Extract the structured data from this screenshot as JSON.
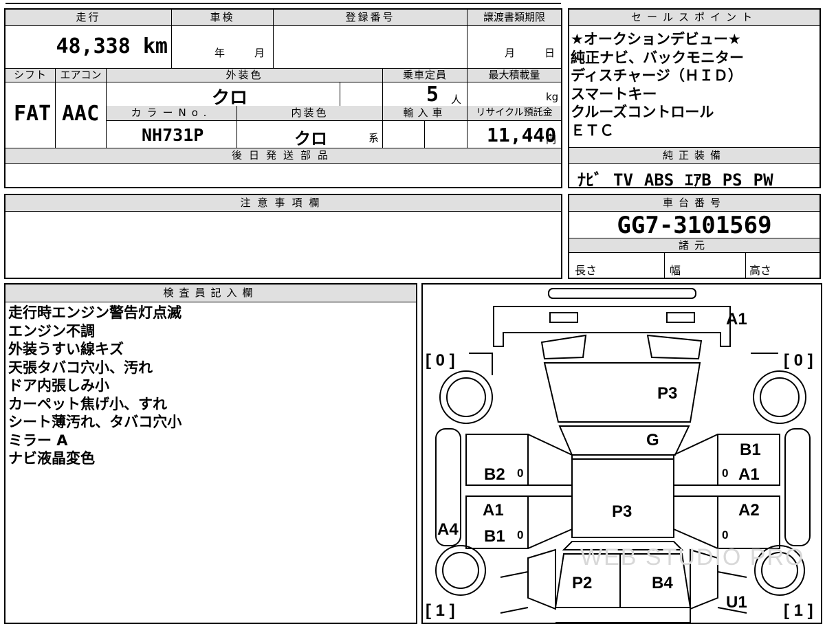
{
  "headers": {
    "mileage": "走行",
    "inspection": "車検",
    "registration": "登録番号",
    "transfer_deadline": "譲渡書類期限",
    "shift": "シフト",
    "aircon": "エアコン",
    "exterior_color": "外装色",
    "capacity": "乗車定員",
    "max_load": "最大積載量",
    "color_no": "カラーNo.",
    "interior_color": "内装色",
    "import": "輸入車",
    "recycle": "リサイクル預託金",
    "later_parts": "後日発送部品",
    "sales_points": "セールスポイント",
    "standard_equipment": "純正装備",
    "notes": "注意事項欄",
    "chassis_no": "車台番号",
    "specs": "諸元",
    "inspector": "検査員記入欄"
  },
  "vehicle": {
    "mileage": "48,338 km",
    "inspection_year_unit": "年",
    "inspection_month_unit": "月",
    "deadline_month_unit": "月",
    "deadline_day_unit": "日",
    "shift": "FAT",
    "aircon": "AAC",
    "exterior_color": "クロ",
    "capacity": "5",
    "capacity_unit": "人",
    "max_load_unit": "kg",
    "color_no": "NH731P",
    "interior_color": "クロ",
    "interior_suffix": "系",
    "recycle_fee": "11,440",
    "recycle_unit": "円",
    "chassis_no": "GG7-3101569"
  },
  "sales_points": [
    "★オークションデビュー★",
    "純正ナビ、バックモニター",
    "ディスチャージ（ＨＩＤ）",
    "スマートキー",
    "クルーズコントロール",
    "ＥＴＣ"
  ],
  "equipment": [
    "ﾅﾋﾞ",
    "TV",
    "ABS",
    "ｴｱB",
    "PS",
    "PW"
  ],
  "specs": {
    "length": "長さ",
    "width": "幅",
    "height": "高さ"
  },
  "inspector_notes": [
    "走行時エンジン警告灯点滅",
    "エンジン不調",
    "外装うすい線キズ",
    "天張タバコ穴小、汚れ",
    "ドア内張しみ小",
    "カーペット焦げ小、すれ",
    "シート薄汚れ、タバコ穴小",
    "ミラー A",
    "ナビ液晶変色"
  ],
  "diagram": {
    "tire_fl": "[ 0 ]",
    "tire_fr": "[ 0 ]",
    "tire_rl": "[ 1 ]",
    "tire_rr": "[ 1 ]",
    "front_bumper": "A1",
    "hood": "P3",
    "windshield": "G",
    "roof": "P3",
    "right_front_fender": "B1",
    "right_front_door": "A1",
    "right_rear_door": "A2",
    "left_front_door": "B2",
    "left_rear_door_a": "A1",
    "left_rear_door_b": "B1",
    "left_sill": "A4",
    "rear_left": "P2",
    "rear_right": "B4",
    "rear_bumper_right": "U1",
    "mark_zero": "0"
  },
  "watermark": "WEB STUDIO PRO"
}
